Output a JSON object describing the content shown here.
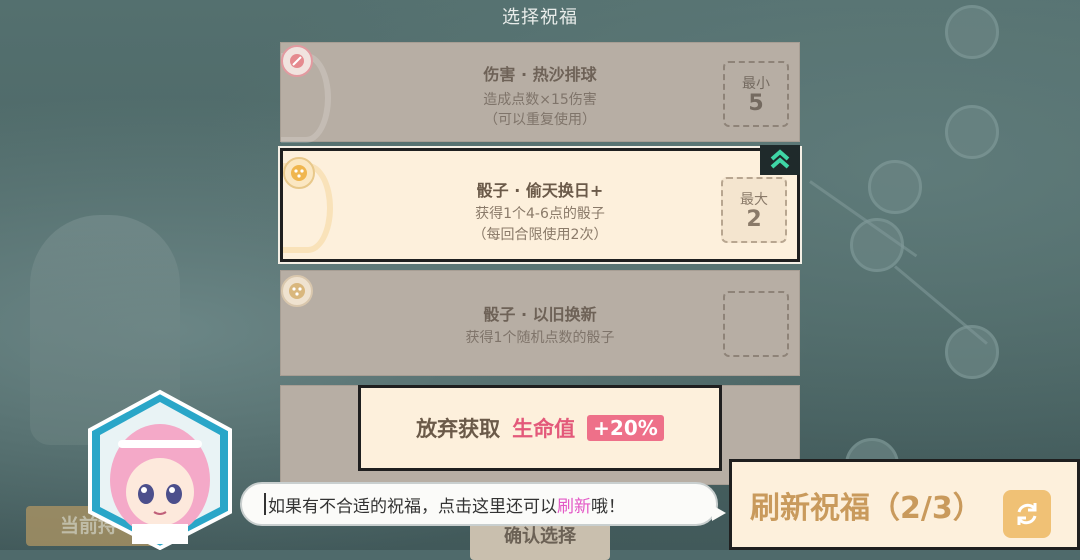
{
  "header": {
    "title": "选择祝福"
  },
  "cards": [
    {
      "title": "伤害 · 热沙排球",
      "desc1": "造成点数×15伤害",
      "desc2": "（可以重复使用）",
      "badge_label": "最小",
      "badge_value": "5",
      "selected": false
    },
    {
      "title": "骰子 · 偷天换日+",
      "desc1": "获得1个4-6点的骰子",
      "desc2": "（每回合限使用2次）",
      "badge_label": "最大",
      "badge_value": "2",
      "selected": true
    },
    {
      "title": "骰子 · 以旧换新",
      "desc1": "获得1个随机点数的骰子",
      "desc2": "",
      "badge_label": "",
      "badge_value": "",
      "selected": false
    }
  ],
  "abandon": {
    "label": "放弃获取",
    "stat": "生命值",
    "bonus": "+20%"
  },
  "bottom": {
    "left_button": "当前持",
    "confirm": "确认选择"
  },
  "speech": {
    "prefix": "如果有不合适的祝福，点击这里还可以",
    "highlight": "刷新",
    "suffix": "哦！"
  },
  "refresh": {
    "label": "刷新祝福（2/3）"
  },
  "icons": {
    "card1": "sword-icon",
    "card2": "dice-icon",
    "card3": "dice-icon",
    "upgrade": "double-chevron-up-icon",
    "refresh": "refresh-icon"
  },
  "colors": {
    "accent_pink": "#e3597a",
    "highlight_magenta": "#e357c6",
    "refresh_orange": "#f0c175"
  }
}
